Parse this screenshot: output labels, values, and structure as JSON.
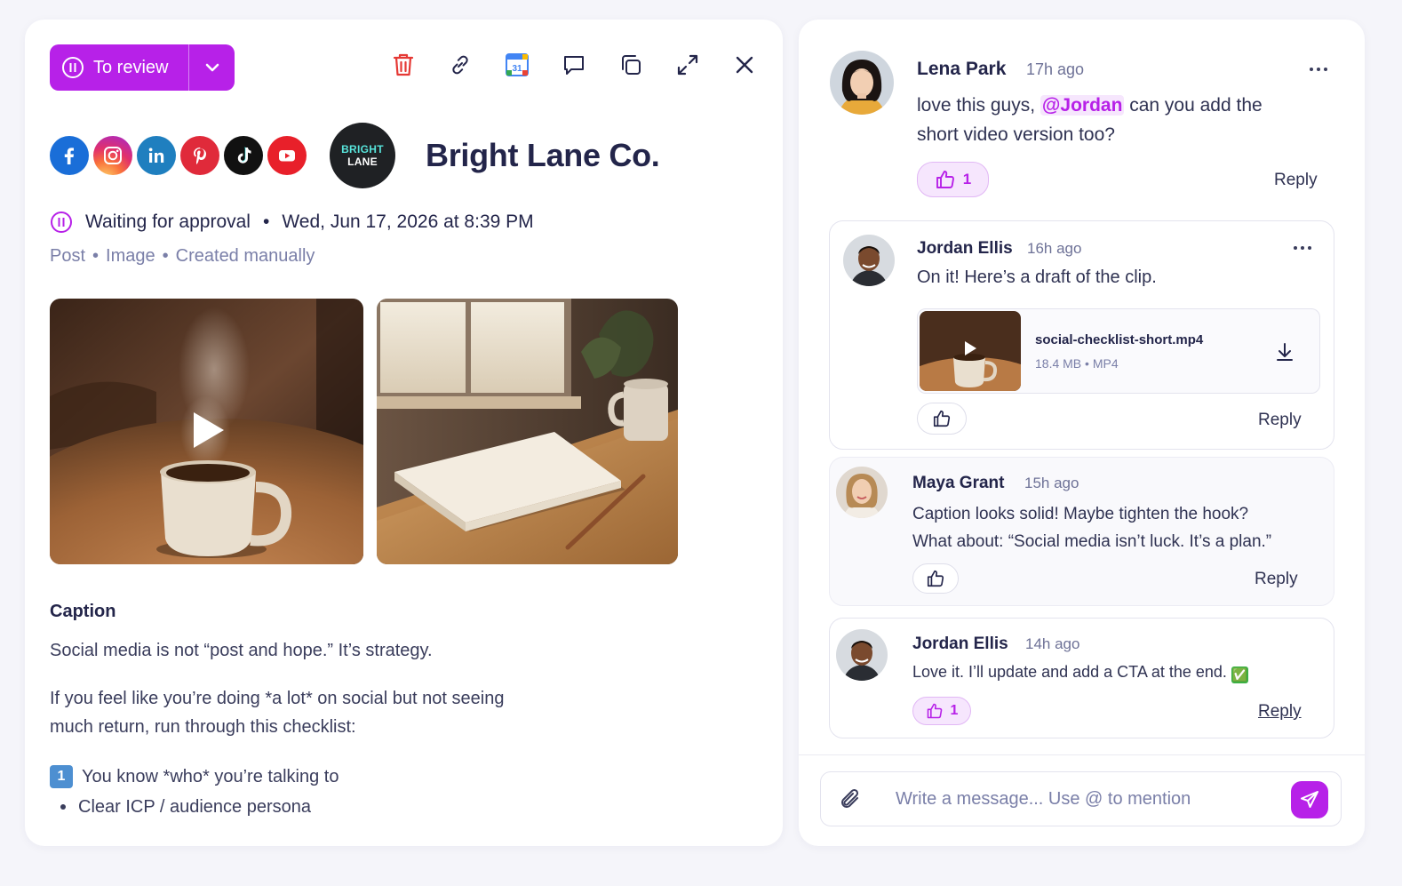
{
  "post": {
    "status_button_label": "To review",
    "brand_logo_line1": "BRIGHT",
    "brand_logo_line2": "LANE",
    "brand_name": "Bright Lane Co.",
    "status_text": "Waiting for approval",
    "datetime": "Wed, Jun 17, 2026 at 8:39 PM",
    "meta": [
      "Post",
      "Image",
      "Created manually"
    ],
    "social_networks": [
      "facebook-icon",
      "instagram-icon",
      "linkedin-icon",
      "pinterest-icon",
      "tiktok-icon",
      "youtube-icon"
    ],
    "caption_title": "Caption",
    "caption_line1": "Social media is not “post and hope.” It’s strategy.",
    "caption_line2a": "If you feel like you’re doing *a lot* on social but not seeing",
    "caption_line2b": "much return, run through this checklist:",
    "checklist_num": "1",
    "checklist_item": "You know *who* you’re talking to",
    "checklist_sub": "Clear ICP / audience persona",
    "toolbar_icons": [
      "trash-icon",
      "link-icon",
      "calendar-icon",
      "comment-icon",
      "copy-icon",
      "expand-icon",
      "close-icon"
    ],
    "calendar_day": "31"
  },
  "comments": [
    {
      "name": "Lena Park",
      "time": "17h ago",
      "text_before": "love this guys, ",
      "mention": "@Jordan",
      "text_after_1": " can you add the",
      "text_after_2": "short video version too?",
      "likes": "1",
      "reply": "Reply"
    },
    {
      "name": "Jordan Ellis",
      "time": "16h ago",
      "text": "On it! Here’s a draft of the clip.",
      "attachment": {
        "filename": "social-checklist-short.mp4",
        "size": "18.4 MB",
        "type": "MP4"
      },
      "reply": "Reply"
    },
    {
      "name": "Maya Grant",
      "time": "15h ago",
      "text_1": "Caption looks solid! Maybe tighten the hook?",
      "text_2": "What about: “Social media isn’t luck. It’s a plan.”",
      "reply": "Reply"
    },
    {
      "name": "Jordan Ellis",
      "time": "14h ago",
      "text": "Love it. I’ll update and add a CTA at the end.",
      "emoji": "✅",
      "likes": "1",
      "reply": "Reply"
    }
  ],
  "composer": {
    "placeholder": "Write a message... Use @ to mention"
  },
  "colors": {
    "accent": "#b721e8",
    "text": "#23254a",
    "muted": "#7a7fa8",
    "danger": "#e53935"
  }
}
